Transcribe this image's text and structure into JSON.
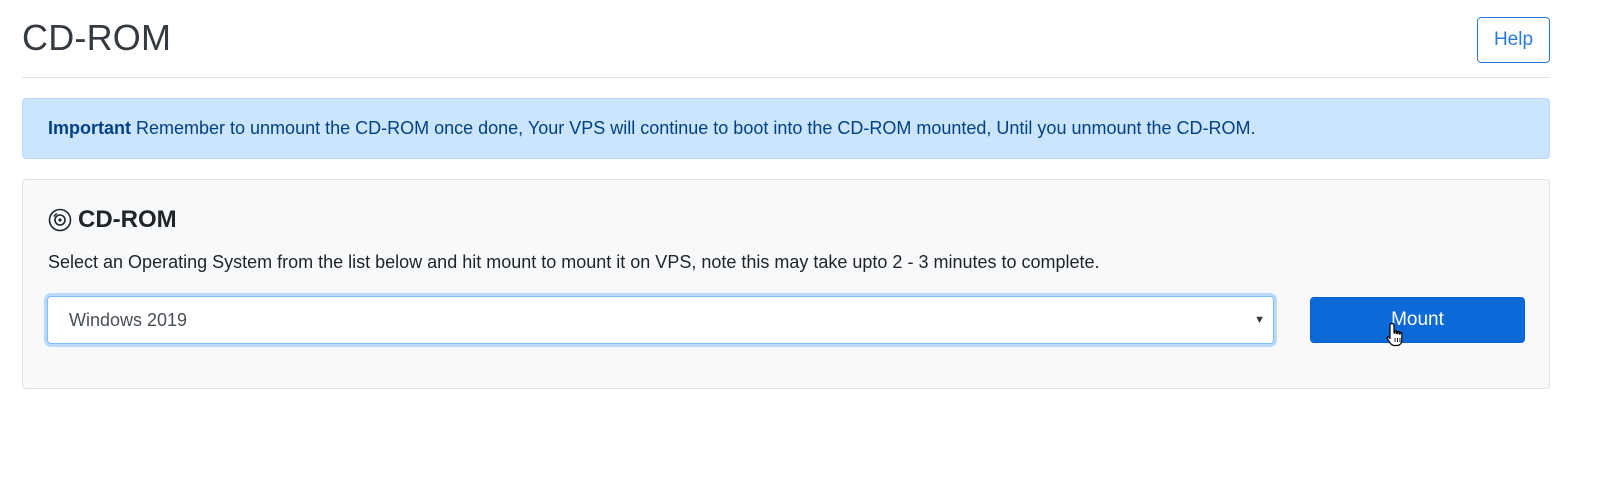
{
  "header": {
    "title": "CD-ROM",
    "help_label": "Help"
  },
  "alert": {
    "strong": "Important",
    "text": " Remember to unmount the CD-ROM once done, Your VPS will continue to boot into the CD-ROM mounted, Until you unmount the CD-ROM."
  },
  "card": {
    "icon": "disc-icon",
    "title": "CD-ROM",
    "description": "Select an Operating System from the list below and hit mount to mount it on VPS, note this may take upto 2 - 3 minutes to complete.",
    "select_value": "Windows 2019",
    "mount_label": "Mount"
  },
  "colors": {
    "alert_bg": "#cce5ff",
    "alert_text": "#004085",
    "primary": "#0b6ad8",
    "help_outline": "#2a7bd4"
  }
}
